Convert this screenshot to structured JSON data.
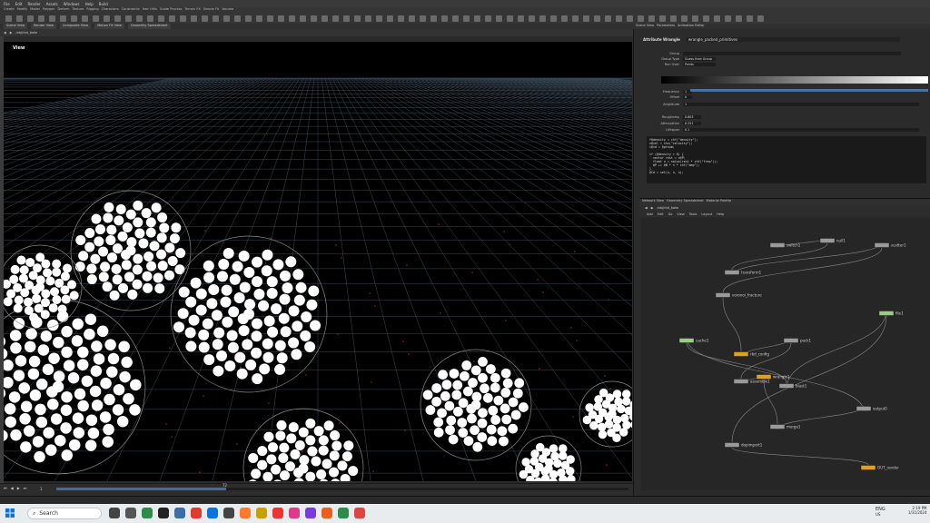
{
  "menubar": {
    "items": [
      "File",
      "Edit",
      "Render",
      "Assets",
      "Windows",
      "Help",
      "Build"
    ]
  },
  "shelf": {
    "tabs": [
      "Create",
      "Modify",
      "Model",
      "Polygon",
      "Deform",
      "Texture",
      "Rigging",
      "Characters",
      "Constraints",
      "Hair Utils",
      "Guide Process",
      "Terrain FX",
      "Simple FX",
      "Volume"
    ]
  },
  "viewer": {
    "tabs": [
      "Scene View",
      "Render View",
      "Composite View",
      "Motion FX View",
      "Geometry Spreadsheet"
    ],
    "path": "/obj/rbd_bake",
    "label": "View"
  },
  "parameters": {
    "tabs": [
      "Scene View",
      "Parameters",
      "Animation Editor"
    ],
    "node_type": "Attribute Wrangle",
    "node_name": "wrangle_packed_primitives",
    "fields": [
      {
        "label": "Group",
        "value": ""
      },
      {
        "label": "Group Type",
        "value": "Guess from Group"
      },
      {
        "label": "Run Over",
        "value": "Points"
      },
      {
        "label": "Frequency",
        "value": "1"
      },
      {
        "label": "Offset",
        "value": "0"
      },
      {
        "label": "Amplitude",
        "value": "1"
      },
      {
        "label": "Roughness",
        "value": "0.603"
      },
      {
        "label": "Attenuation",
        "value": "0.251"
      },
      {
        "label": "Lifespan",
        "value": "0.1"
      }
    ],
    "code": "f@density = chf(\"density\");\nv@vel = chv(\"velocity\");\ni@id = @ptnum;\n\nif (@density > 0) {\n  vector rest = v@P;\n  float n = noise(rest * chf(\"freq\"));\n  @P += @N * n * chf(\"amp\");\n}\n@Cd = set(n, n, n);"
  },
  "network": {
    "tabs": [
      "Network View",
      "Geometry Spreadsheet",
      "Material Palette"
    ],
    "path": "/obj/rbd_bake",
    "menu": [
      "Add",
      "Edit",
      "Go",
      "View",
      "Tools",
      "Layout",
      "Help"
    ],
    "nodes": [
      {
        "label": "switch1",
        "color": "#9a9a9a"
      },
      {
        "label": "null1",
        "color": "#9a9a9a"
      },
      {
        "label": "transform1",
        "color": "#9a9a9a"
      },
      {
        "label": "scatter1",
        "color": "#9a9a9a"
      },
      {
        "label": "voronoi_fracture",
        "color": "#9a9a9a"
      },
      {
        "label": "rbd_config",
        "color": "#e0a020"
      },
      {
        "label": "pack1",
        "color": "#9a9a9a"
      },
      {
        "label": "assemble1",
        "color": "#9a9a9a"
      },
      {
        "label": "wrangle1",
        "color": "#e0a020"
      },
      {
        "label": "merge1",
        "color": "#9a9a9a"
      },
      {
        "label": "output0",
        "color": "#9a9a9a"
      },
      {
        "label": "cache1",
        "color": "#9ec98a"
      },
      {
        "label": "blast1",
        "color": "#9a9a9a"
      },
      {
        "label": "file1",
        "color": "#9ec98a"
      },
      {
        "label": "dopimport1",
        "color": "#9a9a9a"
      },
      {
        "label": "OUT_render",
        "color": "#e0a020"
      }
    ]
  },
  "timeline": {
    "start": "1",
    "end": "240",
    "current": "72"
  },
  "taskbar": {
    "search_placeholder": "Search",
    "lang": "ENG",
    "region": "US",
    "time": "2:19 PM",
    "date": "1/31/2024"
  }
}
